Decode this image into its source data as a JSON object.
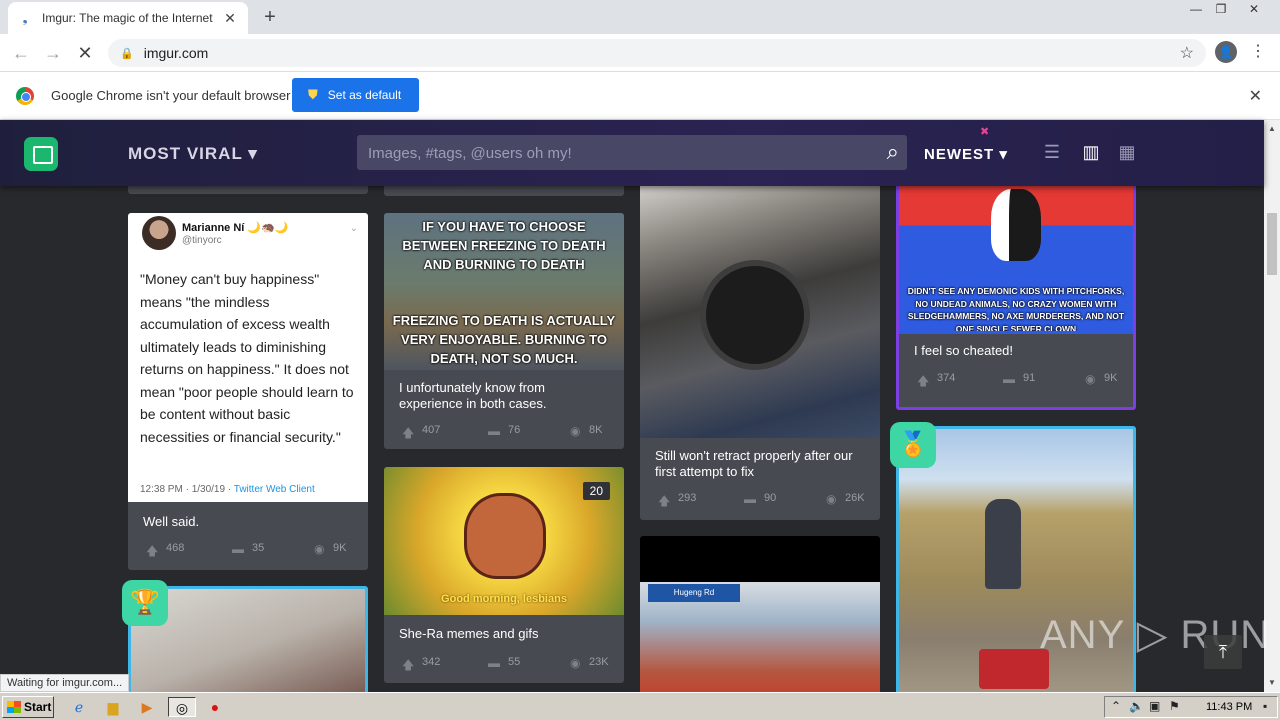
{
  "browser": {
    "tab_title": "Imgur: The magic of the Internet",
    "tab_close": "✕",
    "new_tab": "+",
    "url": "imgur.com",
    "status": "Waiting for imgur.com...",
    "window_controls": [
      "—",
      "❐",
      "✕"
    ]
  },
  "infobar": {
    "message": "Google Chrome isn't your default browser",
    "button": "Set as default",
    "close": "✕"
  },
  "imgur": {
    "sort_main": "MOST VIRAL ▾",
    "search_placeholder": "Images, #tags, @users oh my!",
    "sort_new": "NEWEST ▾"
  },
  "posts": [
    {
      "tweet_name": "Marianne Ní 🌙🦔🌙",
      "tweet_handle": "@tinyorc",
      "tweet_text": "\"Money can't buy happiness\" means \"the mindless accumulation of excess wealth ultimately leads to diminishing returns on happiness.\" It does not mean \"poor people should learn to be content without basic necessities or financial security.\"",
      "tweet_meta": "12:38 PM · 1/30/19 · ",
      "tweet_client": "Twitter Web Client",
      "caption": "Well said.",
      "upvotes": "468",
      "comments": "35",
      "views": "9K"
    },
    {
      "meme_top": "IF YOU HAVE TO CHOOSE BETWEEN FREEZING TO DEATH AND BURNING TO DEATH",
      "meme_bottom": "FREEZING TO DEATH IS ACTUALLY VERY ENJOYABLE. BURNING TO DEATH, NOT SO MUCH.",
      "caption": "I unfortunately know from experience in both cases.",
      "upvotes": "407",
      "comments": "76",
      "views": "8K"
    },
    {
      "caption": "Still won't retract properly after our first attempt to fix",
      "upvotes": "293",
      "comments": "90",
      "views": "26K"
    },
    {
      "meme_bottom": "DIDN'T SEE ANY DEMONIC KIDS WITH PITCHFORKS, NO UNDEAD ANIMALS, NO CRAZY WOMEN WITH SLEDGEHAMMERS, NO AXE MURDERERS, AND NOT ONE SINGLE SEWER CLOWN",
      "caption": "I feel so cheated!",
      "upvotes": "374",
      "comments": "91",
      "views": "9K"
    },
    {
      "count": "20",
      "image_text": "Good morning, lesbians",
      "caption": "She-Ra memes and gifs",
      "upvotes": "342",
      "comments": "55",
      "views": "23K"
    },
    {
      "sign_text": "Hugeng Rd"
    }
  ],
  "watermark": "ANY ▷ RUN",
  "taskbar": {
    "start": "Start",
    "clock": "11:43 PM"
  },
  "colors": {
    "imgur_green": "#1bb76e",
    "card_bg": "#474a51",
    "page_bg": "#27292d",
    "promoted_border": "#7b3fe4",
    "badge": "#3fd6a5"
  }
}
